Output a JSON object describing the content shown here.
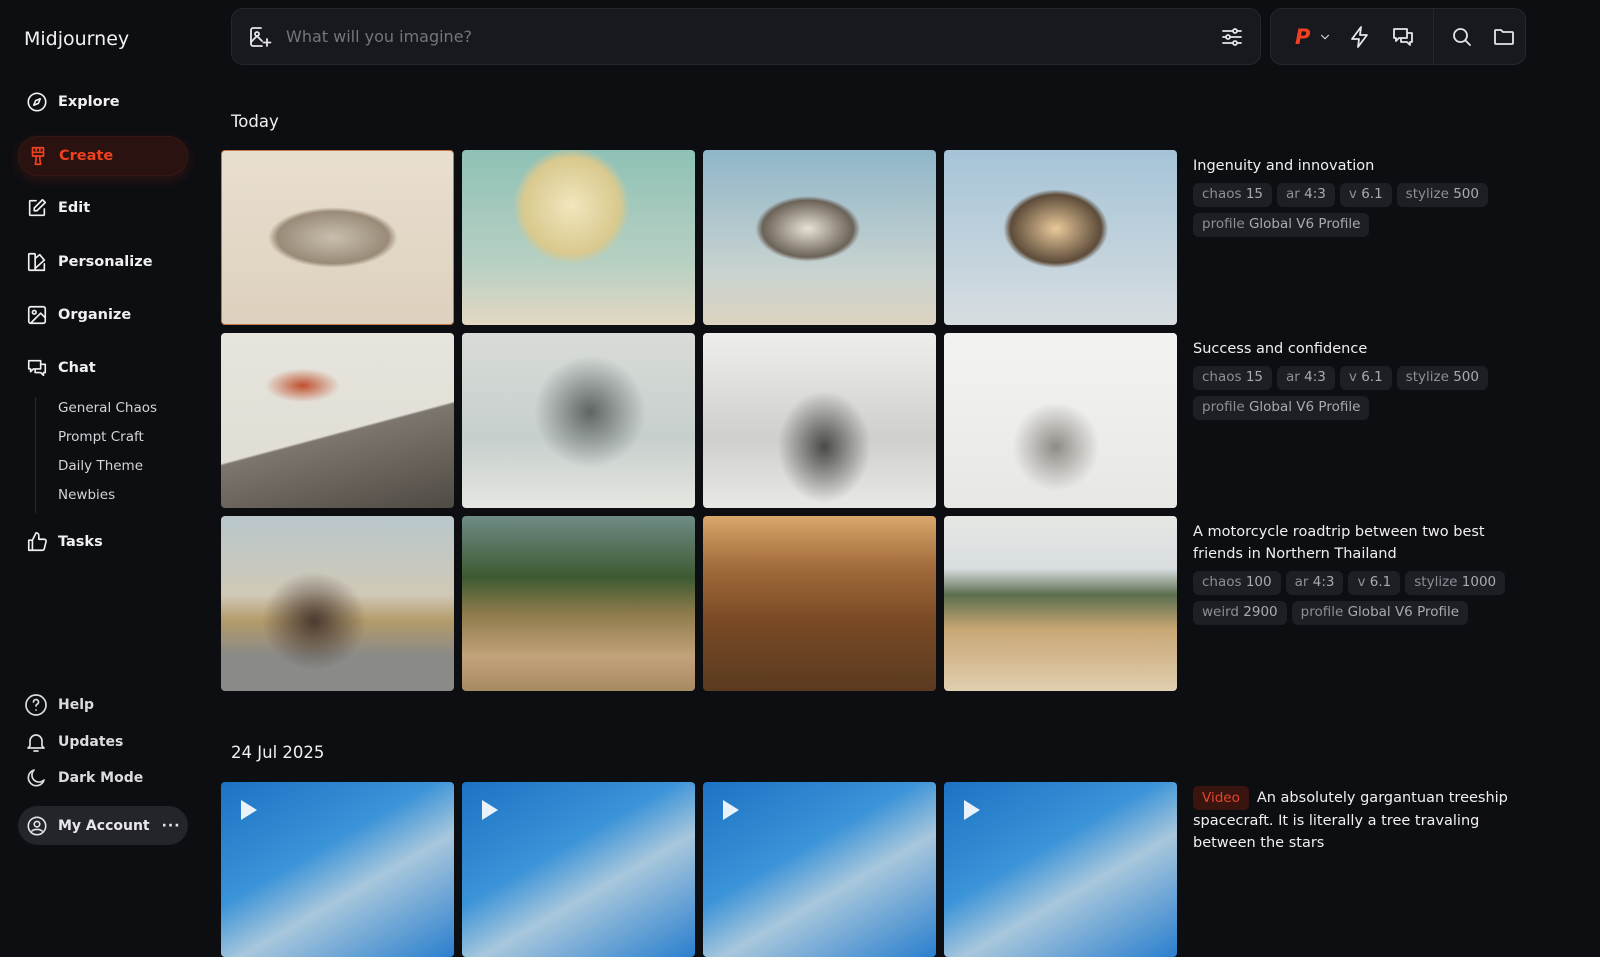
{
  "app": {
    "title": "Midjourney"
  },
  "sidebar": {
    "items": [
      {
        "label": "Explore"
      },
      {
        "label": "Create"
      },
      {
        "label": "Edit"
      },
      {
        "label": "Personalize"
      },
      {
        "label": "Organize"
      },
      {
        "label": "Chat"
      },
      {
        "label": "Tasks"
      }
    ],
    "chat_rooms": [
      "General Chaos",
      "Prompt Craft",
      "Daily Theme",
      "Newbies"
    ],
    "bottom": [
      {
        "label": "Help"
      },
      {
        "label": "Updates"
      },
      {
        "label": "Dark Mode"
      }
    ],
    "account": "My Account",
    "accent": "#f0401f"
  },
  "search": {
    "placeholder": "What will you imagine?"
  },
  "toolbar": {
    "profile_letter": "P"
  },
  "sections": [
    {
      "heading": "Today",
      "groups": [
        {
          "title": "Ingenuity and innovation",
          "chips": [
            [
              "chaos",
              "15"
            ],
            [
              "ar",
              "4:3"
            ],
            [
              "v",
              "6.1"
            ],
            [
              "stylize",
              "500"
            ],
            [
              "profile",
              "Global V6 Profile"
            ]
          ]
        },
        {
          "title": "Success and confidence",
          "chips": [
            [
              "chaos",
              "15"
            ],
            [
              "ar",
              "4:3"
            ],
            [
              "v",
              "6.1"
            ],
            [
              "stylize",
              "500"
            ],
            [
              "profile",
              "Global V6 Profile"
            ]
          ]
        },
        {
          "title": "A motorcycle roadtrip between two best friends in Northern Thailand",
          "chips": [
            [
              "chaos",
              "100"
            ],
            [
              "ar",
              "4:3"
            ],
            [
              "v",
              "6.1"
            ],
            [
              "stylize",
              "1000"
            ],
            [
              "weird",
              "2900"
            ],
            [
              "profile",
              "Global V6 Profile"
            ]
          ]
        }
      ]
    },
    {
      "heading": "24 Jul 2025",
      "groups": [
        {
          "badge": "Video",
          "title": "An absolutely gargantuan treeship spacecraft. It is literally a tree travaling between the stars"
        }
      ]
    }
  ]
}
